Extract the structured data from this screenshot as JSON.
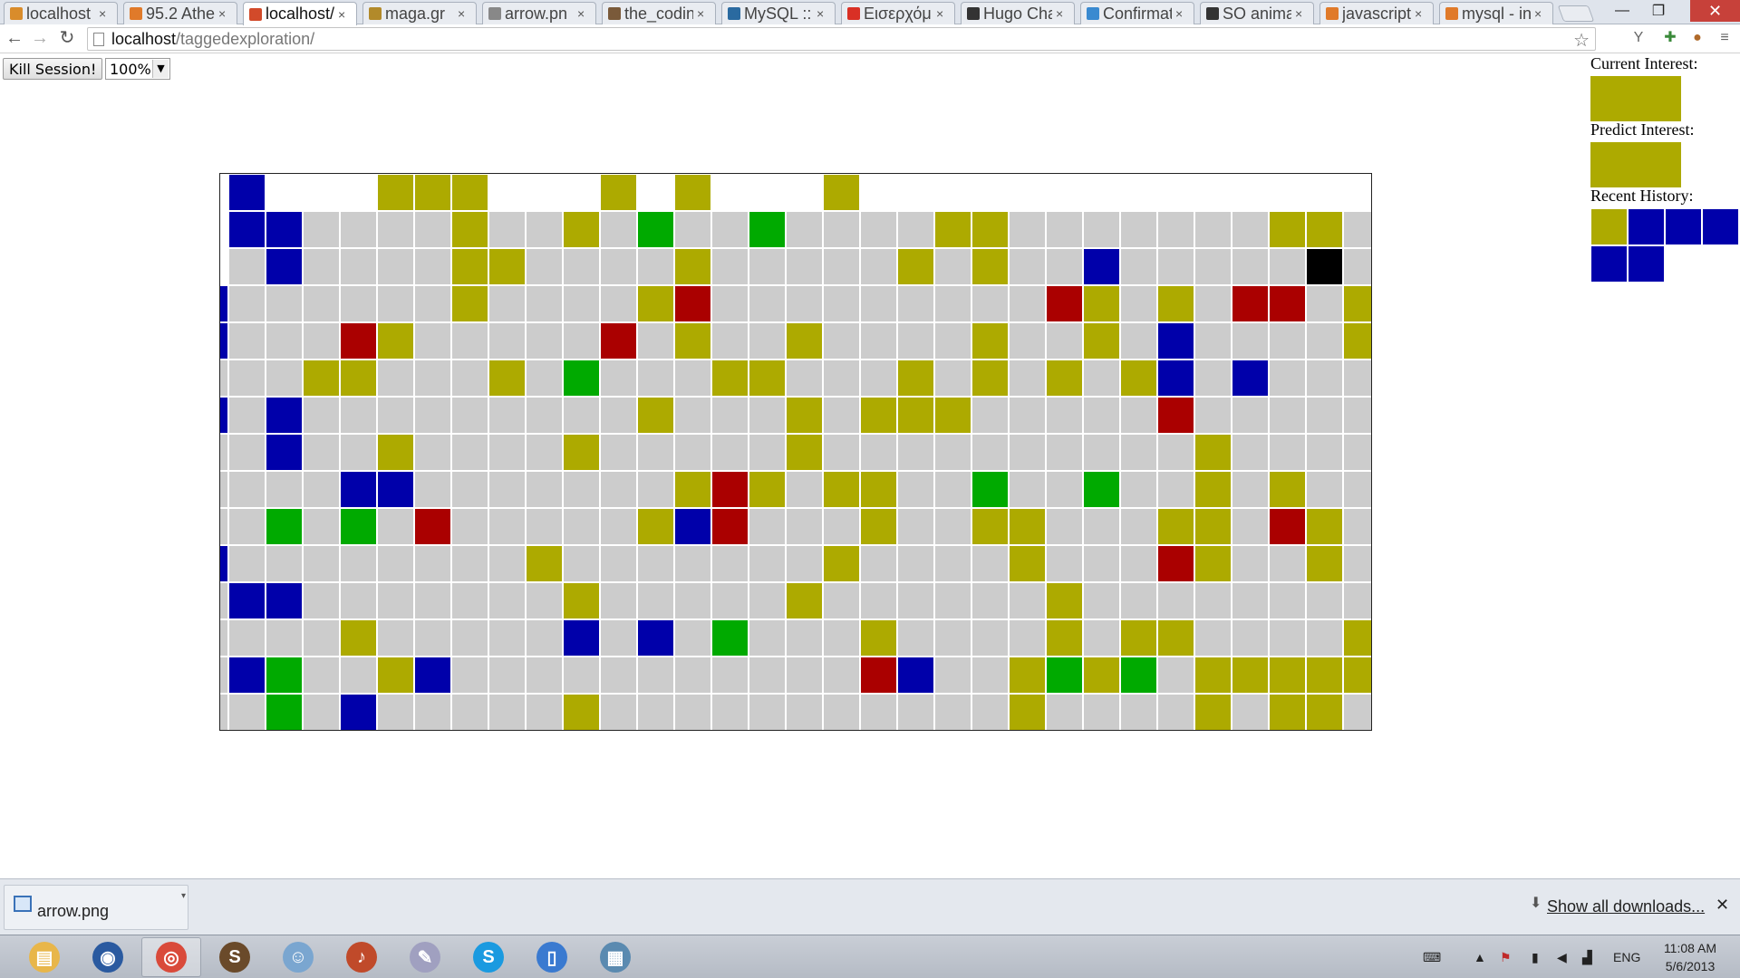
{
  "tabs": [
    {
      "title": "localhost",
      "icon": "pma-icon",
      "color": "#d98c2b"
    },
    {
      "title": "95.2 Athe",
      "icon": "radio-icon",
      "color": "#e07a2a"
    },
    {
      "title": "localhost/",
      "icon": "page-icon",
      "color": "#d24a2a",
      "active": true
    },
    {
      "title": "maga.gr",
      "icon": "maga-icon",
      "color": "#b28a2a"
    },
    {
      "title": "arrow.pn",
      "icon": "file-icon",
      "color": "#888888"
    },
    {
      "title": "the_codin",
      "icon": "coding-icon",
      "color": "#7a5a3a"
    },
    {
      "title": "MySQL ::",
      "icon": "mysql-icon",
      "color": "#2a6aa0"
    },
    {
      "title": "Εισερχόμ",
      "icon": "gmail-icon",
      "color": "#d93025"
    },
    {
      "title": "Hugo Cha",
      "icon": "wikipedia-icon",
      "color": "#333333"
    },
    {
      "title": "Confirmat",
      "icon": "cloud-icon",
      "color": "#3a8ad0"
    },
    {
      "title": "SO anima",
      "icon": "github-icon",
      "color": "#333333"
    },
    {
      "title": "javascript",
      "icon": "stackoverflow-icon",
      "color": "#e07a2a"
    },
    {
      "title": "mysql - in",
      "icon": "stackoverflow-icon",
      "color": "#e07a2a"
    }
  ],
  "window": {
    "min": "—",
    "max": "❐",
    "close": "✕"
  },
  "address": {
    "host": "localhost",
    "path": "/taggedexploration/"
  },
  "controls": {
    "kill_label": "Kill Session!",
    "zoom_value": "100%"
  },
  "colors": {
    "empty": "#cccccc",
    "olive": "#adaa00",
    "blue": "#0000aa",
    "red": "#aa0000",
    "green": "#00aa00",
    "black": "#000000",
    "white": "#ffffff"
  },
  "grid": {
    "legend": "o=olive b=blue r=red g=green k=black .=empty w=white",
    "rows": [
      "wbwwwooowwwowowwwowwwwwwwwwwwwww",
      "wbb....o..o.g..g....oo.......oo.o",
      "w.b....oo....o.....o.o..b.....k..",
      "b......o....or.........ro.o.rr.o.",
      "b...ro.....r.o..o....o..o.b....oo",
      "...oo...o.g...oo...o.o.o.ob.b....",
      "b.b.........o...o.ooo.....r.....o",
      "..b..o....o.....o..........o.....",
      "....bb.......oro.oo..g..g..o.o...",
      "..g.g.r.....obr...o..oo...oo.ro..",
      "b........o.......o....o...ro..o..",
      ".bb.......o.....o......o........o",
      "....o.....b.b.g...o....o.oo....o.",
      ".bg..ob...........rb..ogog.ooooo.o",
      "..g.b.....o...........o....o.oo.oo",
      ".b..b..b.......b..o..oo.o..o..o.."
    ]
  },
  "side": {
    "current_label": "Current Interest:",
    "current_color": "#adaa00",
    "predict_label": "Predict Interest:",
    "predict_color": "#adaa00",
    "history_label": "Recent History:",
    "history": [
      "#adaa00",
      "#0000aa",
      "#0000aa",
      "#0000aa",
      "#0000aa",
      "#0000aa"
    ]
  },
  "download": {
    "file": "arrow.png",
    "show_all": "Show all downloads..."
  },
  "taskbar": {
    "apps": [
      {
        "name": "explorer-icon",
        "color": "#e8b64a",
        "glyph": "▤"
      },
      {
        "name": "media-player-icon",
        "color": "#2a5aa0",
        "glyph": "◉"
      },
      {
        "name": "chrome-icon",
        "color": "#d94a3a",
        "glyph": "◎",
        "on": true
      },
      {
        "name": "sublime-icon",
        "color": "#6a4a2a",
        "glyph": "S"
      },
      {
        "name": "skype-contacts-icon",
        "color": "#7aa6d0",
        "glyph": "☺"
      },
      {
        "name": "speaker-app-icon",
        "color": "#c04a2a",
        "glyph": "♪"
      },
      {
        "name": "paint-icon",
        "color": "#a0a0c0",
        "glyph": "✎"
      },
      {
        "name": "skype-icon",
        "color": "#1a9ae0",
        "glyph": "S"
      },
      {
        "name": "clipboard-icon",
        "color": "#3a7ad0",
        "glyph": "▯"
      },
      {
        "name": "control-panel-icon",
        "color": "#5a8ab0",
        "glyph": "▦"
      }
    ],
    "tray_lang": "ENG",
    "time": "11:08 AM",
    "date": "5/6/2013"
  }
}
